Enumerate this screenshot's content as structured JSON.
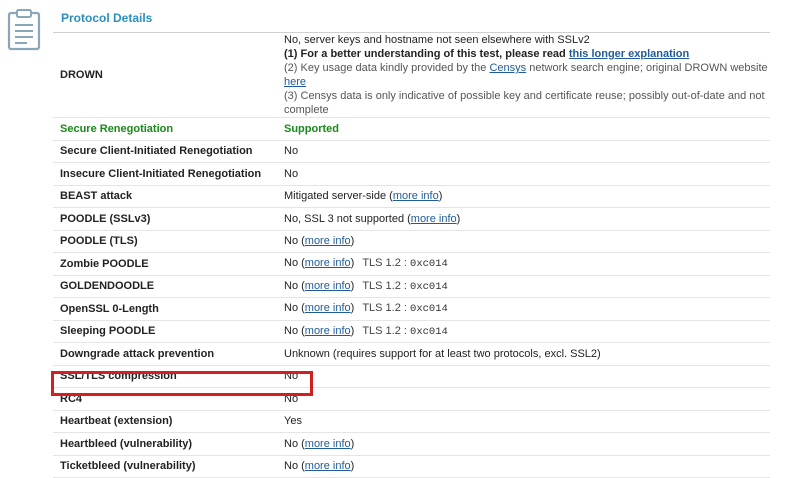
{
  "header": {
    "icon": "clipboard-list-icon",
    "title": "Protocol Details",
    "accent_color": "#2a8fbd"
  },
  "drown": {
    "label": "DROWN",
    "line1": "No, server keys and hostname not seen elsewhere with SSLv2",
    "line2_prefix": "(1) For a better understanding of this test, please read ",
    "line2_link": "this longer explanation",
    "line3_prefix": "(2) Key usage data kindly provided by the ",
    "line3_link": "Censys",
    "line3_mid": " network search engine; original DROWN website ",
    "line3_link2": "here",
    "line4": "(3) Censys data is only indicative of possible key and certificate reuse; possibly out-of-date and not complete"
  },
  "rows": [
    {
      "label": "Secure Renegotiation",
      "value": "Supported",
      "status_color": "#1a8a1a"
    },
    {
      "label": "Secure Client-Initiated Renegotiation",
      "value": "No"
    },
    {
      "label": "Insecure Client-Initiated Renegotiation",
      "value": "No"
    },
    {
      "label": "BEAST attack",
      "value": "Mitigated server-side (",
      "link": "more info",
      "suffix": ")"
    },
    {
      "label": "POODLE (SSLv3)",
      "value": "No, SSL 3 not supported (",
      "link": "more info",
      "suffix": ")"
    },
    {
      "label": "POODLE (TLS)",
      "value": "No (",
      "link": "more info",
      "suffix": ")"
    },
    {
      "label": "Zombie POODLE",
      "value": "No (",
      "link": "more info",
      "suffix": ")",
      "tls": "TLS 1.2 : ",
      "cipher": "0xc014"
    },
    {
      "label": "GOLDENDOODLE",
      "value": "No (",
      "link": "more info",
      "suffix": ")",
      "tls": "TLS 1.2 : ",
      "cipher": "0xc014"
    },
    {
      "label": "OpenSSL 0-Length",
      "value": "No (",
      "link": "more info",
      "suffix": ")",
      "tls": "TLS 1.2 : ",
      "cipher": "0xc014"
    },
    {
      "label": "Sleeping POODLE",
      "value": "No (",
      "link": "more info",
      "suffix": ")",
      "tls": "TLS 1.2 : ",
      "cipher": "0xc014"
    },
    {
      "label": "Downgrade attack prevention",
      "value": "Unknown (requires support for at least two protocols, excl. SSL2)"
    },
    {
      "label": "SSL/TLS compression",
      "value": "No"
    },
    {
      "label": "RC4",
      "value": "No",
      "highlighted": true
    },
    {
      "label": "Heartbeat (extension)",
      "value": "Yes"
    },
    {
      "label": "Heartbleed (vulnerability)",
      "value": "No (",
      "link": "more info",
      "suffix": ")"
    },
    {
      "label": "Ticketbleed (vulnerability)",
      "value": "No (",
      "link": "more info",
      "suffix": ")"
    }
  ],
  "highlight_color": "#d21f1f"
}
